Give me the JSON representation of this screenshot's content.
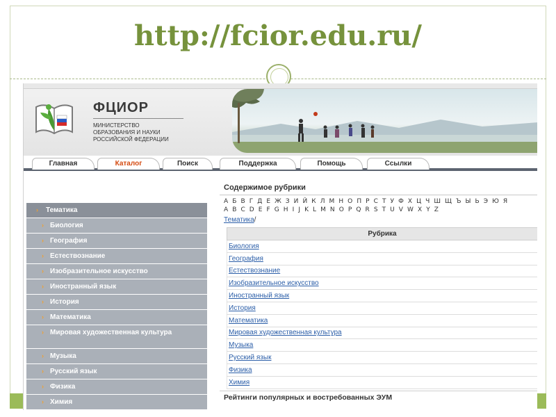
{
  "slide": {
    "url_title": "http://fcior.edu.ru/"
  },
  "site": {
    "logo_title": "ФЦИОР",
    "logo_subtitle": [
      "МИНИСТЕРСТВО",
      "ОБРАЗОВАНИЯ И НАУКИ",
      "РОССИЙСКОЙ ФЕДЕРАЦИИ"
    ]
  },
  "tabs": [
    {
      "label": "Главная",
      "active": false
    },
    {
      "label": "Каталог",
      "active": true
    },
    {
      "label": "Поиск",
      "active": false
    },
    {
      "label": "Поддержка",
      "active": false
    },
    {
      "label": "Помощь",
      "active": false
    },
    {
      "label": "Ссылки",
      "active": false
    }
  ],
  "sidebar": {
    "header": "Тематика",
    "items": [
      "Биология",
      "География",
      "Естествознание",
      "Изобразительное искусство",
      "Иностранный язык",
      "История",
      "Математика",
      "Мировая художественная культура",
      "Музыка",
      "Русский язык",
      "Физика",
      "Химия"
    ]
  },
  "main": {
    "section_title": "Содержимое рубрики",
    "alphabet_cyrillic": "А Б В Г Д Е Ж З И Й К Л М Н О П Р С Т У Ф Х Ц Ч Ш Щ Ъ Ы Ь Э Ю Я",
    "alphabet_latin": "A B C D E F G H I J K L M N O P Q R S T U V W X Y Z",
    "breadcrumb_link": "Тематика",
    "breadcrumb_sep": "/",
    "table_header": "Рубрика",
    "rubrics": [
      "Биология",
      "География",
      "Естествознание",
      "Изобразительное искусство",
      "Иностранный язык",
      "История",
      "Математика",
      "Мировая художественная культура",
      "Музыка",
      "Русский язык",
      "Физика",
      "Химия"
    ],
    "footer_title": "Рейтинги популярных и востребованных ЭУМ"
  },
  "colors": {
    "title_green": "#76923c",
    "accent_orange": "#d44a10",
    "link_blue": "#2b5ea8",
    "sidebar_gray": "#aab0b8"
  }
}
